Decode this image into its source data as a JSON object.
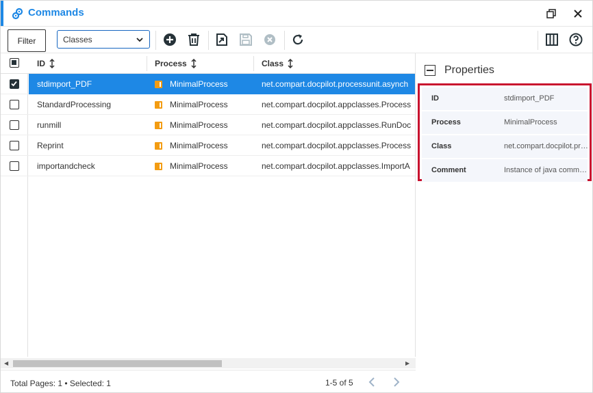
{
  "window": {
    "title": "Commands",
    "icon": "gears-icon"
  },
  "toolbar": {
    "filter_label": "Filter",
    "class_select": {
      "selected": "Classes"
    }
  },
  "table": {
    "columns": [
      {
        "label": "ID"
      },
      {
        "label": "Process"
      },
      {
        "label": "Class"
      }
    ],
    "rows": [
      {
        "id": "stdimport_PDF",
        "process": "MinimalProcess",
        "class": "net.compart.docpilot.processunit.asynch",
        "checked": true
      },
      {
        "id": "StandardProcessing",
        "process": "MinimalProcess",
        "class": "net.compart.docpilot.appclasses.Process",
        "checked": false
      },
      {
        "id": "runmill",
        "process": "MinimalProcess",
        "class": "net.compart.docpilot.appclasses.RunDoc",
        "checked": false
      },
      {
        "id": "Reprint",
        "process": "MinimalProcess",
        "class": "net.compart.docpilot.appclasses.Process",
        "checked": false
      },
      {
        "id": "importandcheck",
        "process": "MinimalProcess",
        "class": "net.compart.docpilot.appclasses.ImportA",
        "checked": false
      }
    ]
  },
  "footer": {
    "info": "Total Pages: 1 • Selected: 1",
    "range": "1-5 of 5"
  },
  "properties": {
    "title": "Properties",
    "items": [
      {
        "key": "ID",
        "value": "stdimport_PDF"
      },
      {
        "key": "Process",
        "value": "MinimalProcess"
      },
      {
        "key": "Class",
        "value": "net.compart.docpilot.processunit.asynch"
      },
      {
        "key": "Comment",
        "value": "Instance of java command"
      }
    ]
  },
  "colors": {
    "accent": "#1e88e5",
    "selected_row": "#1e88e5",
    "highlight_box": "#c8102e",
    "process_icon": "#f39c12"
  }
}
